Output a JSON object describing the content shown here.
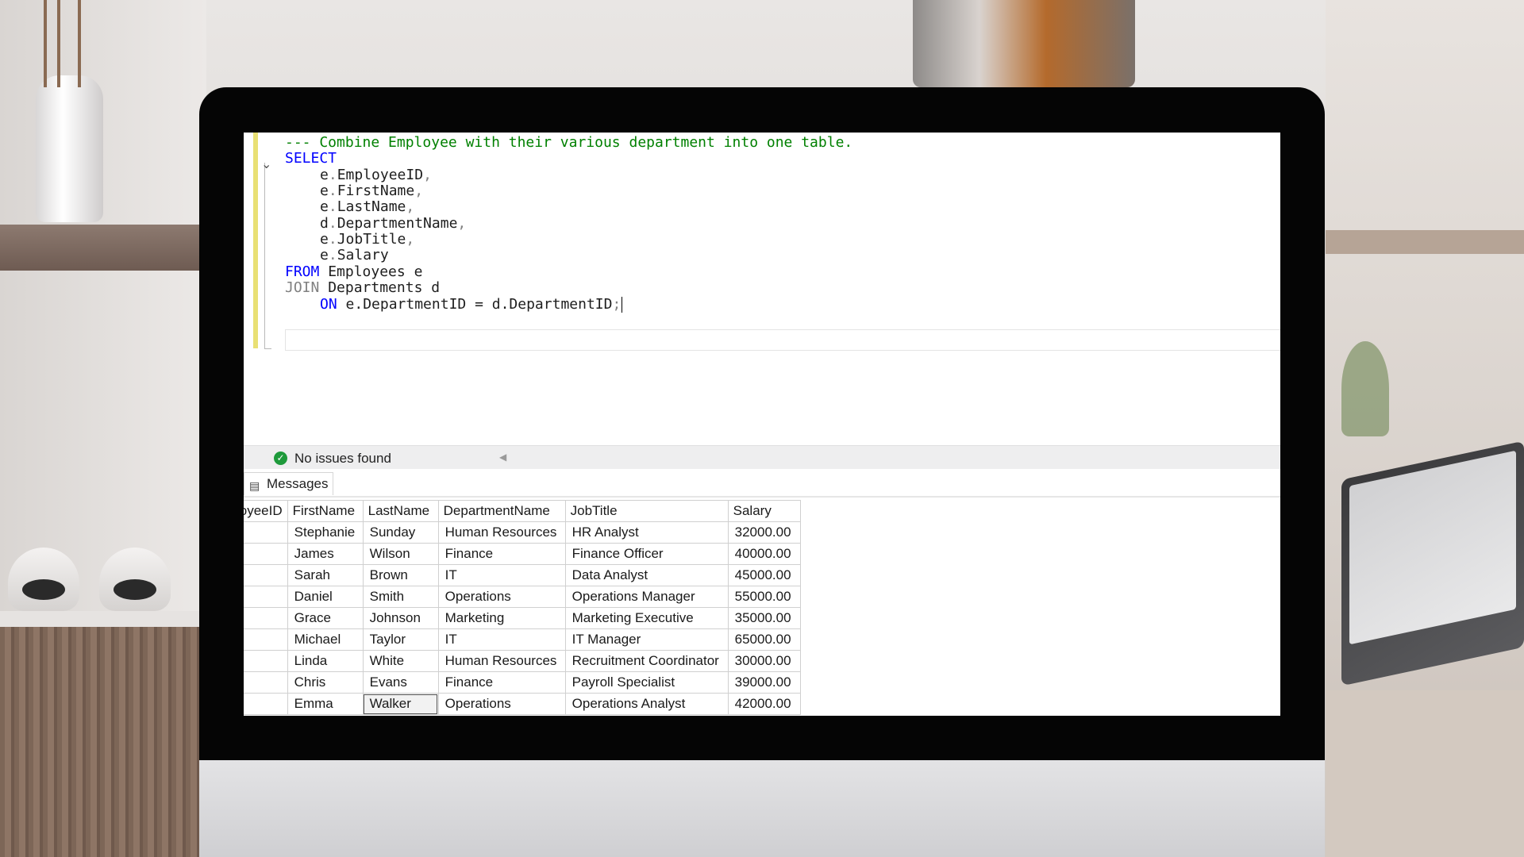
{
  "editor": {
    "lines": [
      {
        "type": "comment",
        "text": "--- Combine Employee with their various department into one table."
      },
      {
        "type": "keyword",
        "text": "SELECT"
      },
      {
        "type": "col",
        "alias": "e",
        "name": "EmployeeID",
        "comma": ","
      },
      {
        "type": "col",
        "alias": "e",
        "name": "FirstName",
        "comma": ","
      },
      {
        "type": "col",
        "alias": "e",
        "name": "LastName",
        "comma": ","
      },
      {
        "type": "col",
        "alias": "d",
        "name": "DepartmentName",
        "comma": ","
      },
      {
        "type": "col",
        "alias": "e",
        "name": "JobTitle",
        "comma": ","
      },
      {
        "type": "col",
        "alias": "e",
        "name": "Salary",
        "comma": ""
      }
    ],
    "from_kw": "FROM",
    "from_rest": " Employees e",
    "join_kw": "JOIN",
    "join_rest": " Departments d",
    "on_kw": "ON",
    "on_rest": " e.DepartmentID = d.DepartmentID",
    "on_end": ";"
  },
  "status": {
    "text": "No issues found"
  },
  "tabs": {
    "messages_label": "Messages"
  },
  "grid": {
    "columns": [
      "loyeeID",
      "FirstName",
      "LastName",
      "DepartmentName",
      "JobTitle",
      "Salary"
    ],
    "rows": [
      [
        "",
        "Stephanie",
        "Sunday",
        "Human Resources",
        "HR Analyst",
        "32000.00"
      ],
      [
        "",
        "James",
        "Wilson",
        "Finance",
        "Finance Officer",
        "40000.00"
      ],
      [
        "",
        "Sarah",
        "Brown",
        "IT",
        "Data Analyst",
        "45000.00"
      ],
      [
        "",
        "Daniel",
        "Smith",
        "Operations",
        "Operations Manager",
        "55000.00"
      ],
      [
        "",
        "Grace",
        "Johnson",
        "Marketing",
        "Marketing Executive",
        "35000.00"
      ],
      [
        "",
        "Michael",
        "Taylor",
        "IT",
        "IT Manager",
        "65000.00"
      ],
      [
        "",
        "Linda",
        "White",
        "Human Resources",
        "Recruitment Coordinator",
        "30000.00"
      ],
      [
        "",
        "Chris",
        "Evans",
        "Finance",
        "Payroll Specialist",
        "39000.00"
      ],
      [
        "",
        "Emma",
        "Walker",
        "Operations",
        "Operations Analyst",
        "42000.00"
      ]
    ]
  },
  "colors": {
    "keyword": "#0000ff",
    "comment": "#008000",
    "ok": "#1e9a3b"
  }
}
